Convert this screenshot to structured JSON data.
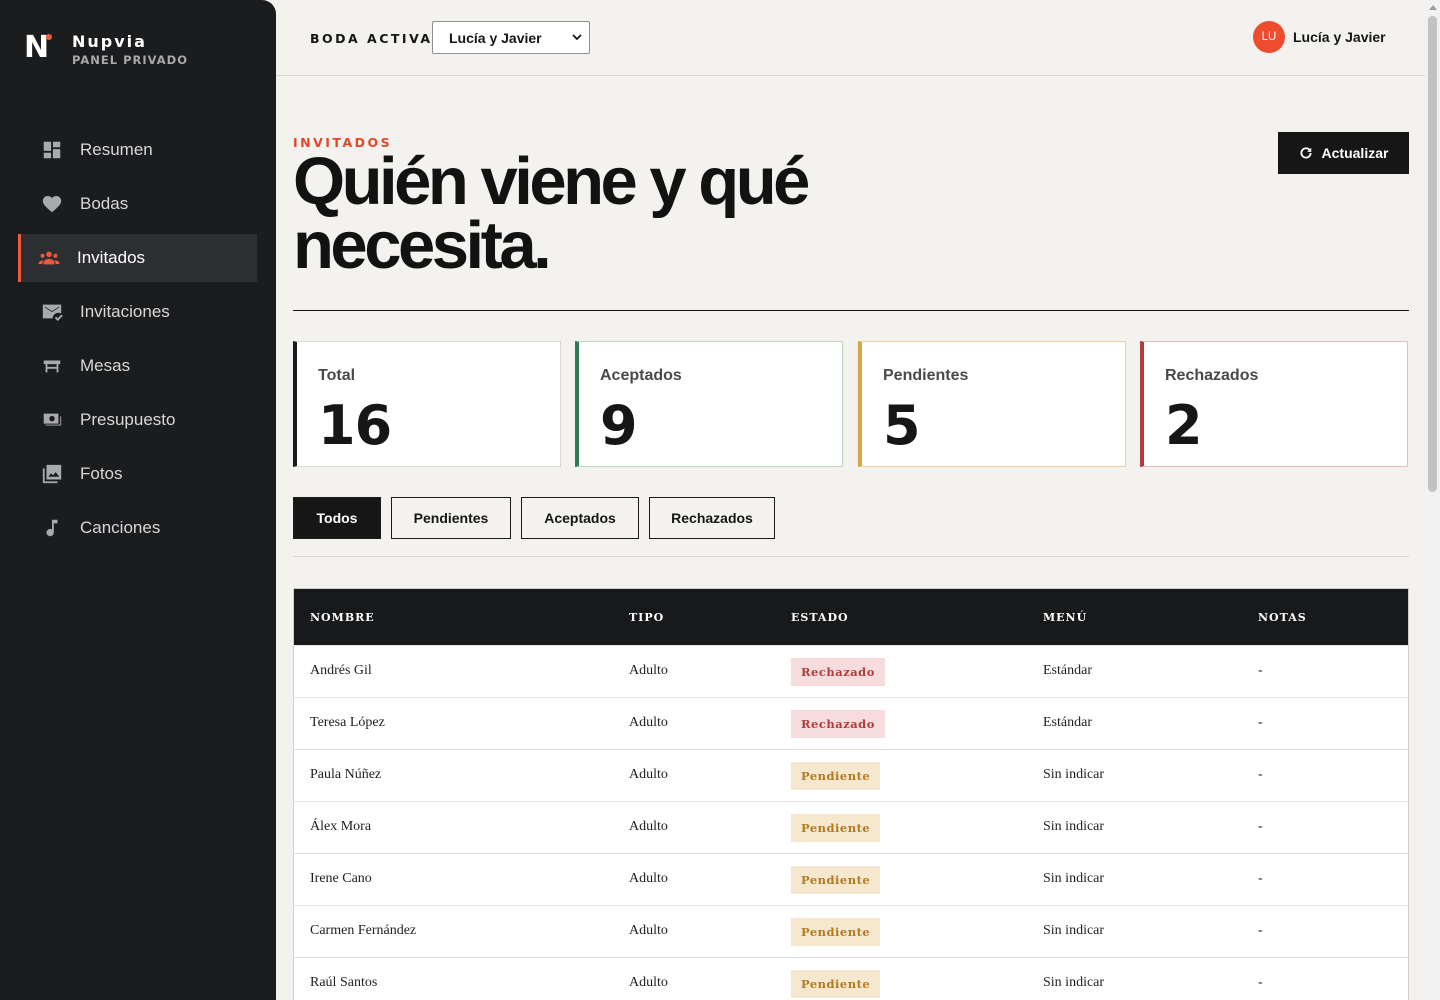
{
  "brand": {
    "logo_letter": "N",
    "name": "Nupvia",
    "subtitle": "PANEL PRIVADO"
  },
  "sidebar": {
    "items": [
      {
        "label": "Resumen",
        "icon": "dashboard-icon",
        "active": false
      },
      {
        "label": "Bodas",
        "icon": "heart-icon",
        "active": false
      },
      {
        "label": "Invitados",
        "icon": "people-icon",
        "active": true
      },
      {
        "label": "Invitaciones",
        "icon": "mail-check-icon",
        "active": false
      },
      {
        "label": "Mesas",
        "icon": "table-icon",
        "active": false
      },
      {
        "label": "Presupuesto",
        "icon": "money-icon",
        "active": false
      },
      {
        "label": "Fotos",
        "icon": "photos-icon",
        "active": false
      },
      {
        "label": "Canciones",
        "icon": "music-note-icon",
        "active": false
      }
    ]
  },
  "topbar": {
    "boda_label": "BODA ACTIVA:",
    "boda_selected": "Lucía y Javier",
    "user_initials": "LU",
    "user_name": "Lucía y Javier"
  },
  "page": {
    "eyebrow": "INVITADOS",
    "title": "Quién viene y qué necesita.",
    "refresh_label": "Actualizar"
  },
  "stats": [
    {
      "label": "Total",
      "value": "16"
    },
    {
      "label": "Aceptados",
      "value": "9"
    },
    {
      "label": "Pendientes",
      "value": "5"
    },
    {
      "label": "Rechazados",
      "value": "2"
    }
  ],
  "filters": [
    {
      "label": "Todos",
      "active": true
    },
    {
      "label": "Pendientes",
      "active": false
    },
    {
      "label": "Aceptados",
      "active": false
    },
    {
      "label": "Rechazados",
      "active": false
    }
  ],
  "table": {
    "headers": [
      "NOMBRE",
      "TIPO",
      "ESTADO",
      "MENÚ",
      "NOTAS"
    ],
    "rows": [
      {
        "nombre": "Andrés Gil",
        "tipo": "Adulto",
        "estado": "Rechazado",
        "menu": "Estándar",
        "notas": "-"
      },
      {
        "nombre": "Teresa López",
        "tipo": "Adulto",
        "estado": "Rechazado",
        "menu": "Estándar",
        "notas": "-"
      },
      {
        "nombre": "Paula Núñez",
        "tipo": "Adulto",
        "estado": "Pendiente",
        "menu": "Sin indicar",
        "notas": "-"
      },
      {
        "nombre": "Álex Mora",
        "tipo": "Adulto",
        "estado": "Pendiente",
        "menu": "Sin indicar",
        "notas": "-"
      },
      {
        "nombre": "Irene Cano",
        "tipo": "Adulto",
        "estado": "Pendiente",
        "menu": "Sin indicar",
        "notas": "-"
      },
      {
        "nombre": "Carmen Fernández",
        "tipo": "Adulto",
        "estado": "Pendiente",
        "menu": "Sin indicar",
        "notas": "-"
      },
      {
        "nombre": "Raúl Santos",
        "tipo": "Adulto",
        "estado": "Pendiente",
        "menu": "Sin indicar",
        "notas": "-"
      }
    ]
  },
  "colors": {
    "accent": "#ef5a3a",
    "sidebar_bg": "#1b1c1e",
    "page_bg": "#f3f2ee",
    "accepted": "#2f7a52",
    "pending": "#dba545",
    "rejected": "#b53a3a"
  }
}
